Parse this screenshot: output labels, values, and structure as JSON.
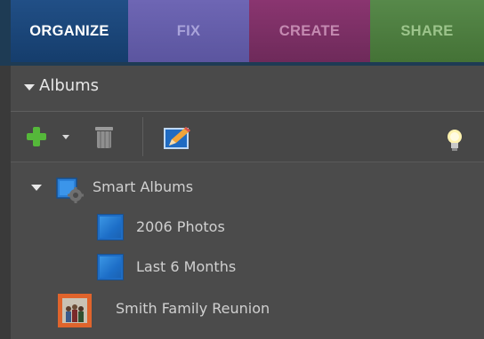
{
  "tabs": [
    {
      "label": "ORGANIZE",
      "active": true
    },
    {
      "label": "FIX",
      "active": false
    },
    {
      "label": "CREATE",
      "active": false
    },
    {
      "label": "SHARE",
      "active": false
    }
  ],
  "albums_panel": {
    "title": "Albums",
    "toolbar": {
      "add_icon": "plus-icon",
      "add_menu_icon": "chevron-down-icon",
      "delete_icon": "trash-icon",
      "edit_icon": "pencil-icon",
      "tip_icon": "lightbulb-icon"
    },
    "tree": {
      "smart_albums": {
        "label": "Smart Albums",
        "icon": "smart-album-icon",
        "children": [
          {
            "label": "2006 Photos",
            "icon": "album-icon"
          },
          {
            "label": "Last 6 Months",
            "icon": "album-icon"
          }
        ]
      },
      "albums": [
        {
          "label": "Smith Family Reunion",
          "icon": "photo-album-icon"
        }
      ]
    }
  },
  "colors": {
    "organize": "#1d4679",
    "fix": "#645eab",
    "create": "#7c2f65",
    "share": "#4f7f41",
    "panel_bg": "#4b4b4b",
    "add_green": "#55b83a",
    "album_blue": "#2a7fd6"
  }
}
